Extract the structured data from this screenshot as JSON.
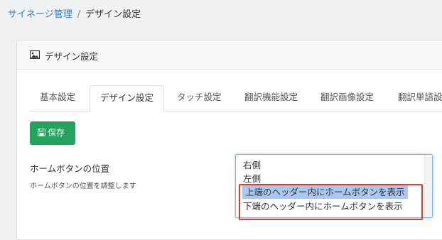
{
  "breadcrumb": {
    "parent": "サイネージ管理",
    "separator": "/",
    "current": "デザイン設定"
  },
  "card": {
    "icon": "image-icon",
    "title": "デザイン設定"
  },
  "tabs": [
    {
      "label": "基本設定",
      "active": false
    },
    {
      "label": "デザイン設定",
      "active": true
    },
    {
      "label": "タッチ設定",
      "active": false
    },
    {
      "label": "翻訳機能設定",
      "active": false
    },
    {
      "label": "翻訳画像設定",
      "active": false
    },
    {
      "label": "翻訳単語設",
      "active": false
    }
  ],
  "save_button": {
    "icon": "floppy-disk-icon",
    "label": "保存"
  },
  "home_button_position": {
    "label": "ホームボタンの位置",
    "help": "ホームボタンの位置を調整します",
    "options": [
      "右側",
      "左側",
      "上端のヘッダー内にホームボタンを表示",
      "下端のヘッダー内にホームボタンを表示"
    ],
    "selected": "上端のヘッダー内にホームボタンを表示"
  },
  "colors": {
    "link": "#2d7fcb",
    "save_button": "#22a45d",
    "selected_option": "#a7c9f1",
    "annotation_box": "#e23b2a"
  }
}
